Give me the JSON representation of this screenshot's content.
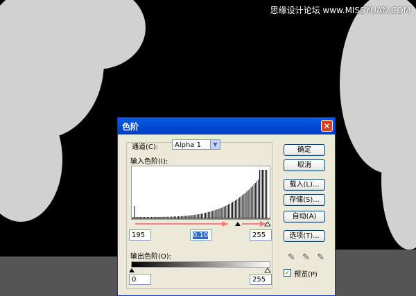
{
  "watermark": "思缘设计论坛 www.MISSYUAN.COM",
  "dialog": {
    "title": "色阶",
    "close_glyph": "✕",
    "channel_label": "通道(C):",
    "channel_value": "Alpha 1",
    "input_levels_label": "输入色阶(I):",
    "input_black": "195",
    "input_gamma": "0.10",
    "input_white": "255",
    "output_levels_label": "输出色阶(O):",
    "output_black": "0",
    "output_white": "255",
    "buttons": {
      "ok": "确定",
      "cancel": "取消",
      "load": "载入(L)...",
      "save": "存储(S)...",
      "auto": "自动(A)",
      "options": "选项(T)..."
    },
    "preview_label": "预览(P)",
    "preview_checked": true,
    "icons": [
      "eyedropper-black-icon",
      "eyedropper-gray-icon",
      "eyedropper-white-icon"
    ]
  }
}
